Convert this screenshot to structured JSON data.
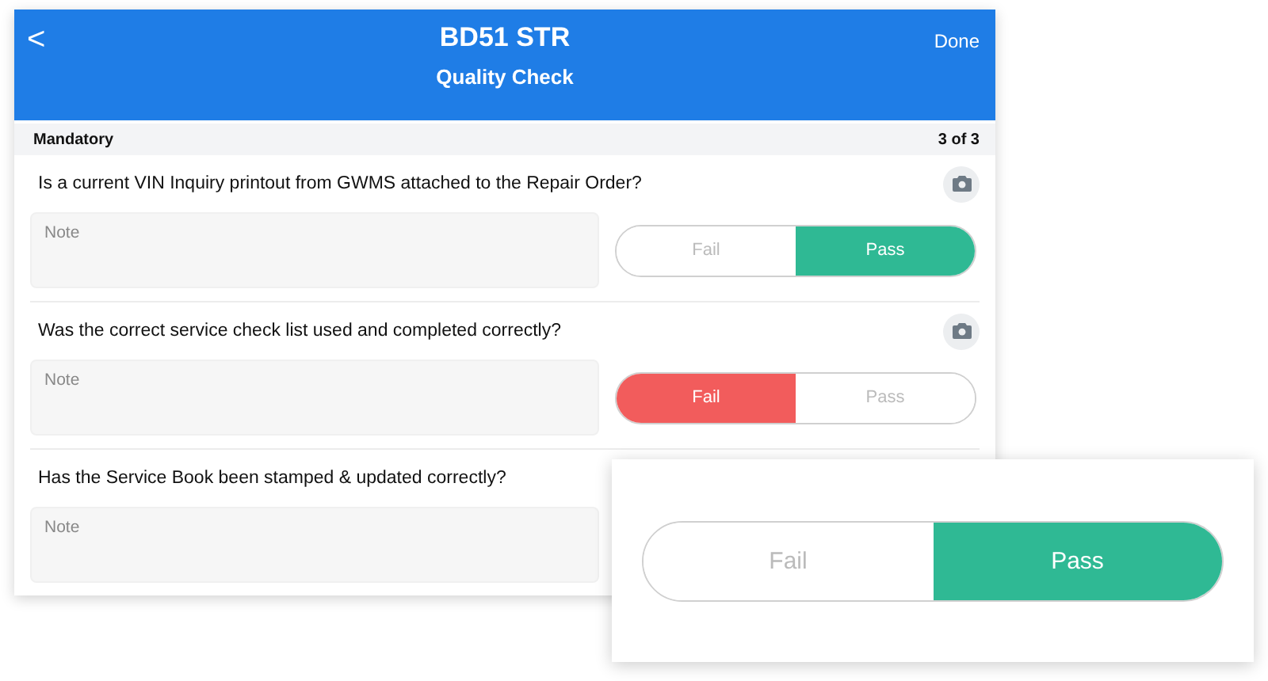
{
  "header": {
    "back": "<",
    "title": "BD51 STR",
    "subtitle": "Quality Check",
    "done": "Done"
  },
  "section": {
    "title": "Mandatory",
    "count": "3 of 3"
  },
  "questions": [
    {
      "text": "Is a current VIN Inquiry printout from GWMS attached to the Repair Order?",
      "placeholder": "Note",
      "camera": true,
      "options": [
        {
          "label": "Fail",
          "kind": "fail",
          "selected": false
        },
        {
          "label": "Pass",
          "kind": "pass",
          "selected": true
        }
      ]
    },
    {
      "text": "Was the correct service check list used and completed correctly?",
      "placeholder": "Note",
      "camera": true,
      "options": [
        {
          "label": "Fail",
          "kind": "fail",
          "selected": true
        },
        {
          "label": "Pass",
          "kind": "pass",
          "selected": false
        }
      ]
    },
    {
      "text": "Has the Service Book been stamped & updated correctly?",
      "placeholder": "Note",
      "camera": false
    }
  ],
  "zoom_toggle": {
    "options": [
      {
        "label": "Fail",
        "kind": "fail",
        "selected": false
      },
      {
        "label": "Pass",
        "kind": "pass",
        "selected": true
      }
    ]
  }
}
